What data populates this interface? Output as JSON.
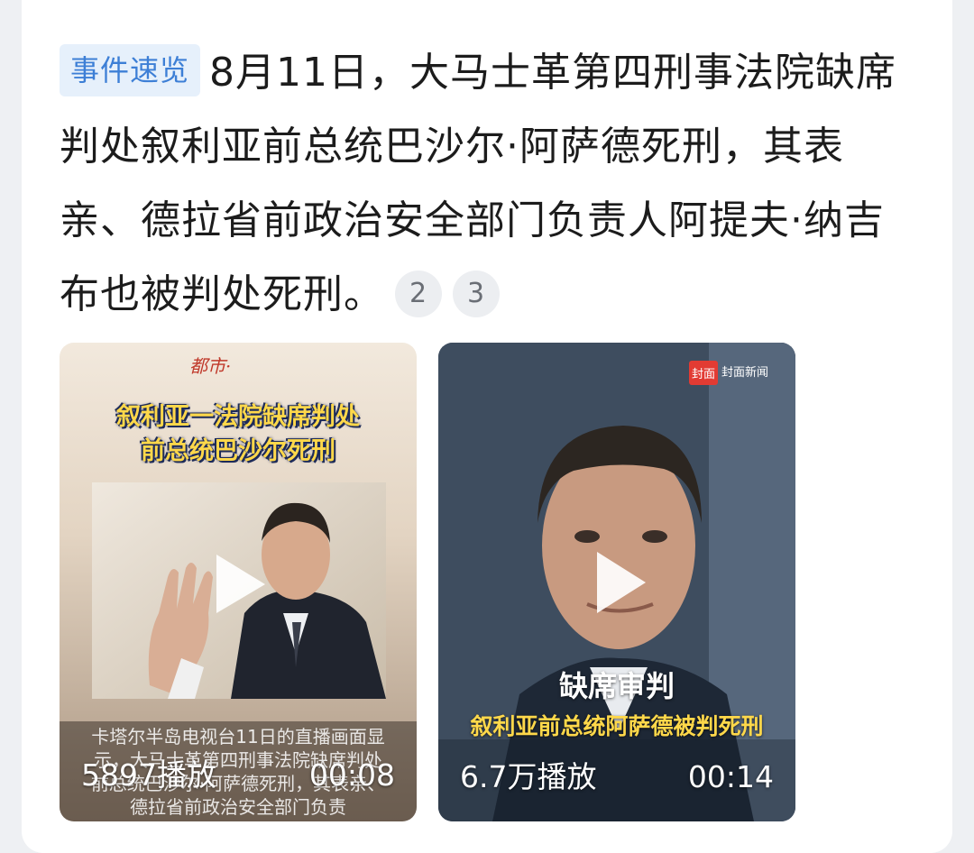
{
  "summary": {
    "tag": "事件速览",
    "text": "8月11日，大马士革第四刑事法院缺席判处叙利亚前总统巴沙尔·阿萨德死刑，其表亲、德拉省前政治安全部门负责人阿提夫·纳吉布也被判处死刑。",
    "citations": [
      "2",
      "3"
    ]
  },
  "videos": [
    {
      "logo": "都市·",
      "headline_line1": "叙利亚一法院缺席判处",
      "headline_line2": "前总统巴沙尔死刑",
      "caption": "卡塔尔半岛电视台11日的直播画面显示，大马士革第四刑事法院缺席判处前总统巴沙尔·阿萨德死刑，其表亲、德拉省前政治安全部门负责",
      "plays": "5897播放",
      "duration": "00:08"
    },
    {
      "logo_badge": "封面",
      "logo_text": "封面新闻",
      "subtitle_line1": "缺席审判",
      "subtitle_line2": "叙利亚前总统阿萨德被判死刑",
      "plays": "6.7万播放",
      "duration": "00:14"
    }
  ],
  "colors": {
    "tag_bg": "#e6f0fb",
    "tag_text": "#3d7fd6",
    "banner_yellow": "#ffd84a"
  }
}
